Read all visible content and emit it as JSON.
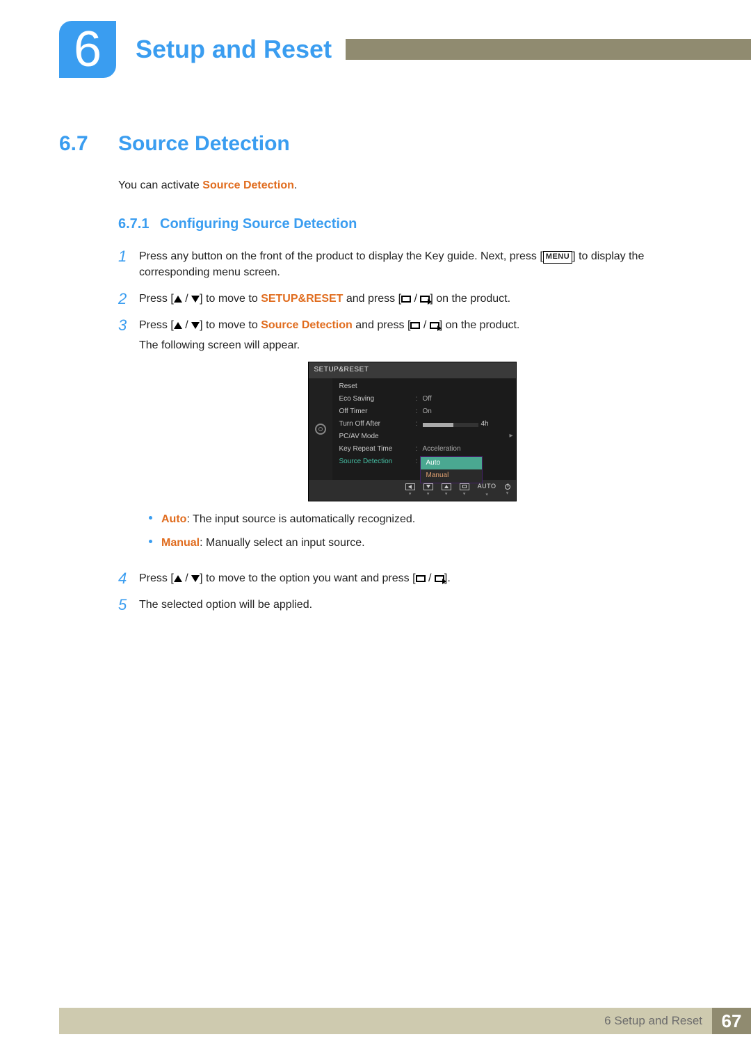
{
  "chapter": {
    "number": "6",
    "title": "Setup and Reset"
  },
  "section": {
    "number": "6.7",
    "title": "Source Detection"
  },
  "intro": {
    "pre": "You can activate ",
    "bold": "Source Detection",
    "post": "."
  },
  "subhead": {
    "number": "6.7.1",
    "title": "Configuring Source Detection"
  },
  "steps": {
    "s1": {
      "n": "1",
      "a": "Press any button on the front of the product to display the Key guide. Next, press [",
      "menu": "MENU",
      "b": "] to display the corresponding menu screen."
    },
    "s2": {
      "n": "2",
      "a": "Press [",
      "b": "] to move to ",
      "bold": "SETUP&RESET",
      "c": " and press [",
      "d": "] on the product."
    },
    "s3": {
      "n": "3",
      "a": "Press [",
      "b": "] to move to ",
      "bold": "Source Detection",
      "c": " and press [",
      "d": "] on the product.",
      "follow": "The following screen will appear."
    },
    "s4": {
      "n": "4",
      "a": "Press [",
      "b": "] to move to the option you want and press [",
      "c": "]."
    },
    "s5": {
      "n": "5",
      "a": "The selected option will be applied."
    }
  },
  "bullets": {
    "auto": {
      "bold": "Auto",
      "text": ": The input source is automatically recognized."
    },
    "manual": {
      "bold": "Manual",
      "text": ": Manually select an input source."
    }
  },
  "osd": {
    "title": "SETUP&RESET",
    "rows": {
      "reset": "Reset",
      "eco": "Eco Saving",
      "eco_val": "Off",
      "offtimer": "Off Timer",
      "offtimer_val": "On",
      "turnoff": "Turn Off After",
      "turnoff_val": "4h",
      "pcav": "PC/AV Mode",
      "keyrep": "Key Repeat Time",
      "keyrep_val": "Acceleration",
      "srcdet": "Source Detection"
    },
    "dropdown": {
      "auto": "Auto",
      "manual": "Manual"
    },
    "footer_auto": "AUTO"
  },
  "footer": {
    "label": "6 Setup and Reset",
    "page": "67"
  }
}
